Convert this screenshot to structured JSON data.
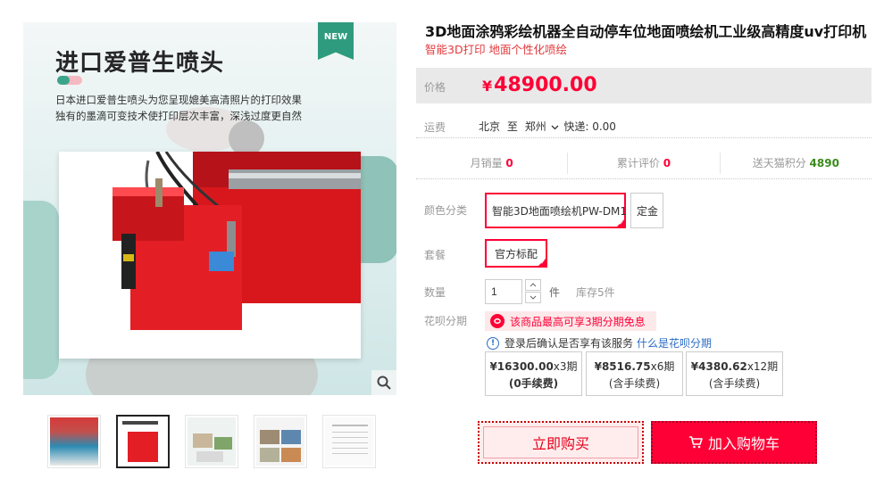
{
  "gallery": {
    "main_title": "进口爱普生喷头",
    "desc_line1": "日本进口爱普生喷头为您呈现媲美高清照片的打印效果",
    "desc_line2": "独有的墨滴可变技术使打印层次丰富，深浅过度更自然",
    "badge": "NEW",
    "thumbnails": 5,
    "active_thumbnail": 2
  },
  "product": {
    "title": "3D地面涂鸦彩绘机器全自动停车位地面喷绘机工业级高精度uv打印机",
    "subtitle": "智能3D打印 地面个性化喷绘"
  },
  "price": {
    "label": "价格",
    "currency": "¥",
    "value": "48900.00"
  },
  "shipping": {
    "label": "运费",
    "from": "北京",
    "to_word": "至",
    "dest": "郑州",
    "express": "快递: 0.00"
  },
  "stats": [
    {
      "label": "月销量",
      "value": "0"
    },
    {
      "label": "累计评价",
      "value": "0"
    },
    {
      "label": "送天猫积分",
      "value": "4890"
    }
  ],
  "color": {
    "label": "颜色分类",
    "options": [
      "智能3D地面喷绘机PW-DM1",
      "定金"
    ],
    "selected": 0
  },
  "package": {
    "label": "套餐",
    "options": [
      "官方标配"
    ],
    "selected": 0
  },
  "quantity": {
    "label": "数量",
    "value": "1",
    "unit": "件",
    "stock": "库存5件"
  },
  "huabei": {
    "label": "花呗分期",
    "promo": "该商品最高可享3期分期免息",
    "notice": "登录后确认是否享有该服务",
    "link": "什么是花呗分期",
    "plans": [
      {
        "amount": "¥16300.00",
        "periods": "x3期",
        "fee": "(0手续费)"
      },
      {
        "amount": "¥8516.75",
        "periods": "x6期",
        "fee": "(含手续费)"
      },
      {
        "amount": "¥4380.62",
        "periods": "x12期",
        "fee": "(含手续费)"
      }
    ]
  },
  "actions": {
    "buy_now": "立即购买",
    "add_cart": "加入购物车"
  },
  "colors": {
    "accent": "#ff0036",
    "link": "#2b6cc4",
    "brand_green": "#2f9b7e"
  }
}
